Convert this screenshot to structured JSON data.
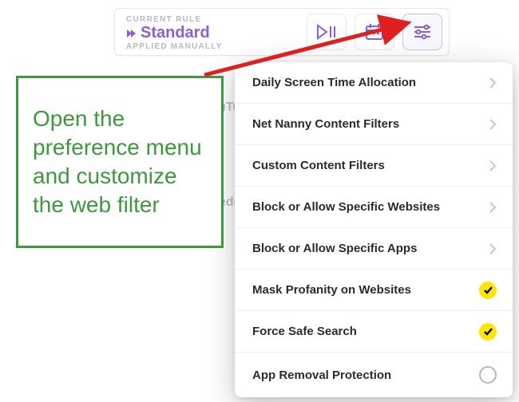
{
  "rule": {
    "label": "CURRENT RULE",
    "name": "Standard",
    "sub": "APPLIED MANUALLY"
  },
  "menu": {
    "items": [
      {
        "label": "Daily Screen Time Allocation",
        "kind": "nav"
      },
      {
        "label": "Net Nanny Content Filters",
        "kind": "nav"
      },
      {
        "label": "Custom Content Filters",
        "kind": "nav"
      },
      {
        "label": "Block or Allow Specific Websites",
        "kind": "nav"
      },
      {
        "label": "Block or Allow Specific Apps",
        "kind": "nav"
      },
      {
        "label": "Mask Profanity on Websites",
        "kind": "on"
      },
      {
        "label": "Force Safe Search",
        "kind": "on"
      },
      {
        "label": "App Removal Protection",
        "kind": "off"
      }
    ]
  },
  "annotation": {
    "text": "Open the preference menu and customize the web filter"
  },
  "bg": {
    "a": "uTu",
    "b": "edr"
  },
  "colors": {
    "accent": "#8a5fd6",
    "annot": "#3c9a3d",
    "toggle_on": "#ffe600"
  }
}
